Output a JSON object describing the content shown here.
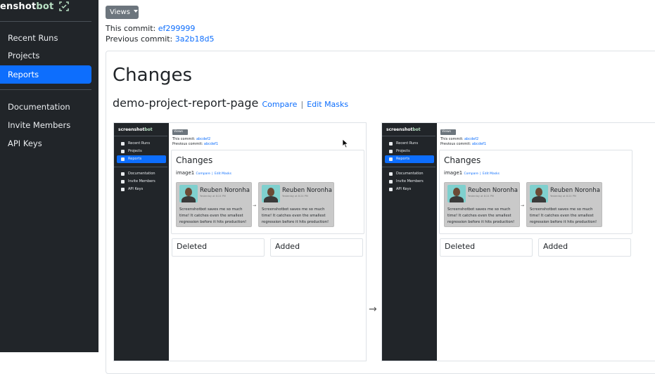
{
  "sidebar": {
    "brand_prefix": "enshot",
    "brand_suffix": "bot",
    "items": [
      {
        "label": "Recent Runs",
        "active": false
      },
      {
        "label": "Projects",
        "active": false
      },
      {
        "label": "Reports",
        "active": true
      },
      {
        "label": "Documentation",
        "active": false
      },
      {
        "label": "Invite Members",
        "active": false
      },
      {
        "label": "API Keys",
        "active": false
      }
    ]
  },
  "header": {
    "views_label": "Views",
    "this_commit_label": "This commit:",
    "this_commit": "ef299999",
    "previous_commit_label": "Previous commit:",
    "previous_commit": "3a2b18d5"
  },
  "main": {
    "title": "Changes",
    "report_name": "demo-project-report-page",
    "compare_label": "Compare",
    "separator": "|",
    "edit_masks_label": "Edit Masks"
  },
  "screenshot": {
    "brand_prefix": "screenshot",
    "brand_suffix": "bot",
    "menu": [
      "Recent Runs",
      "Projects",
      "Reports",
      "Documentation",
      "Invite Members",
      "API Keys"
    ],
    "views_label": "Views",
    "this_commit_label": "This commit:",
    "this_commit": "abcdef2",
    "previous_commit_label": "Previous commit:",
    "previous_commit": "abcdef1",
    "title": "Changes",
    "image_name": "image1",
    "compare_label": "Compare",
    "separator": "|",
    "edit_masks_label": "Edit Masks",
    "testimonial_name": "Reuben Noronha",
    "testimonial_time": "Yesterday at 8:24 PM",
    "testimonial_quote": "Screenshotbot saves me so much time! It catches even the smallest regression before it hits production!",
    "arrow": "→",
    "deleted_label": "Deleted",
    "added_label": "Added"
  },
  "compare_arrow": "→",
  "colors": {
    "sidebar_bg": "#212529",
    "accent": "#0d6efd",
    "views_button": "#6c757d",
    "brand_accent": "#b8e0c3"
  }
}
